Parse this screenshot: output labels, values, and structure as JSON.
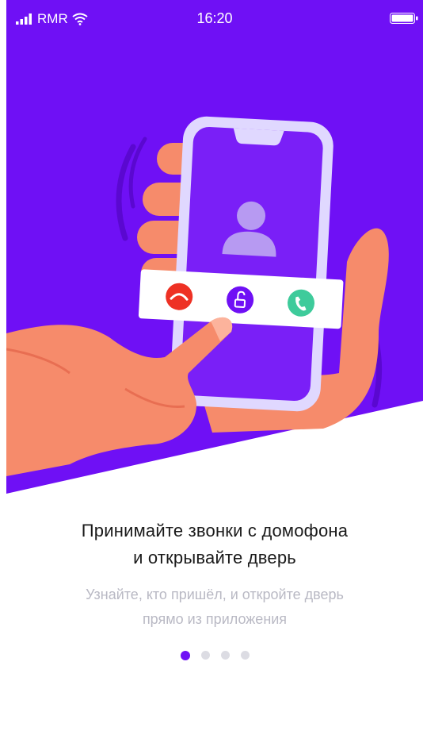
{
  "status_bar": {
    "carrier": "RMR",
    "time": "16:20",
    "signal_icon": "signal-bars-icon",
    "wifi_icon": "wifi-icon",
    "battery_icon": "battery-full-icon"
  },
  "onboarding": {
    "title_line1": "Принимайте звонки с домофона",
    "title_line2": "и открывайте дверь",
    "subtitle_line1": "Узнайте, кто пришёл, и откройте дверь",
    "subtitle_line2": "прямо из приложения",
    "pages": {
      "total": 4,
      "current": 1
    }
  },
  "colors": {
    "brand_purple": "#6f10f5",
    "decline_red": "#ee3124",
    "accept_green": "#3ecb9b",
    "hand_skin": "#f68b6b",
    "phone_frame": "#e0d8ff"
  },
  "illustration": {
    "call_actions": [
      "decline-call-icon",
      "unlock-door-icon",
      "accept-call-icon"
    ]
  }
}
